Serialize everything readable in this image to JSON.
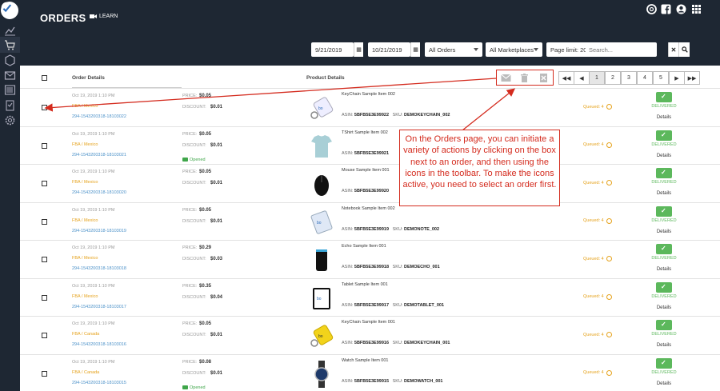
{
  "header": {
    "title": "ORDERS",
    "learn_label": "LEARN",
    "icons": [
      "help-ring-icon",
      "facebook-icon",
      "user-icon",
      "apps-grid-icon"
    ]
  },
  "sidebar": {
    "items": [
      "logo-icon",
      "chart-icon",
      "cart-icon",
      "box-icon",
      "mail-icon",
      "barcode-icon",
      "clipboard-icon",
      "settings-icon"
    ]
  },
  "filters": {
    "date_from": "9/21/2019",
    "date_to": "10/21/2019",
    "order_filter": "All Orders",
    "marketplace_filter": "All Marketplaces",
    "page_limit": "Page limit: 20",
    "search_placeholder": "Search..."
  },
  "table": {
    "col_order": "Order Details",
    "col_product": "Product Details"
  },
  "pagination": [
    "1",
    "2",
    "3",
    "4",
    "5"
  ],
  "labels": {
    "price": "PRICE:",
    "discount": "DISCOUNT:",
    "asin": "ASIN:",
    "sku": "SKU:",
    "delivered": "DELIVERED",
    "details": "Details",
    "opened": "Opened"
  },
  "orders": [
    {
      "date": "Oct 19, 2019 1:10 PM",
      "fba": "FBA / Mexico",
      "id": "294-1543200318-18103022",
      "price": "$0.05",
      "discount": "$0.01",
      "opened": false,
      "product": "KeyChain Sample Item 002",
      "asin": "5BFB5E3E99922",
      "sku": "DEMOKEYCHAIN_002",
      "queued": "Queued: 4",
      "thumb": "keychain"
    },
    {
      "date": "Oct 19, 2019 1:10 PM",
      "fba": "FBA / Mexico",
      "id": "294-1543200318-18103021",
      "price": "$0.05",
      "discount": "$0.01",
      "opened": true,
      "product": "TShirt Sample Item 002",
      "asin": "5BFB5E3E99921",
      "sku": "",
      "queued": "Queued: 4",
      "thumb": "tshirt"
    },
    {
      "date": "Oct 19, 2019 1:10 PM",
      "fba": "FBA / Mexico",
      "id": "294-1543200318-18103020",
      "price": "$0.05",
      "discount": "$0.01",
      "opened": false,
      "product": "Mouse Sample Item 001",
      "asin": "5BFB5E3E99920",
      "sku": "",
      "queued": "Queued: 4",
      "thumb": "mouse"
    },
    {
      "date": "Oct 19, 2019 1:10 PM",
      "fba": "FBA / Mexico",
      "id": "294-1543200318-18103019",
      "price": "$0.05",
      "discount": "$0.01",
      "opened": false,
      "product": "Notebook Sample Item 002",
      "asin": "5BFB5E3E99919",
      "sku": "DEMONOTE_002",
      "queued": "Queued: 4",
      "thumb": "notebook"
    },
    {
      "date": "Oct 19, 2019 1:10 PM",
      "fba": "FBA / Mexico",
      "id": "294-1543200318-18103018",
      "price": "$0.29",
      "discount": "$0.03",
      "opened": false,
      "product": "Echo Sample Item 001",
      "asin": "5BFB5E3E99918",
      "sku": "DEMOECHO_001",
      "queued": "Queued: 4",
      "thumb": "echo"
    },
    {
      "date": "Oct 19, 2019 1:10 PM",
      "fba": "FBA / Mexico",
      "id": "294-1543200318-18103017",
      "price": "$0.35",
      "discount": "$0.04",
      "opened": false,
      "product": "Tablet Sample Item 001",
      "asin": "5BFB5E3E99917",
      "sku": "DEMOTABLET_001",
      "queued": "Queued: 4",
      "thumb": "tablet"
    },
    {
      "date": "Oct 19, 2019 1:10 PM",
      "fba": "FBA / Canada",
      "id": "294-1543200318-18103016",
      "price": "$0.05",
      "discount": "$0.01",
      "opened": false,
      "product": "KeyChain Sample Item 001",
      "asin": "5BFB5E3E99916",
      "sku": "DEMOKEYCHAIN_001",
      "queued": "Queued: 4",
      "thumb": "keychain-yellow"
    },
    {
      "date": "Oct 19, 2019 1:10 PM",
      "fba": "FBA / Canada",
      "id": "294-1543200318-18103015",
      "price": "$0.08",
      "discount": "$0.01",
      "opened": true,
      "product": "Watch Sample Item 001",
      "asin": "5BFB5E3E99915",
      "sku": "DEMOWATCH_001",
      "queued": "Queued: 4",
      "thumb": "watch"
    }
  ],
  "annotation": {
    "text": "On the Orders page, you can initiate a variety of actions by clicking on the box next to an order, and then using the icons in the toolbar. To make the icons active, you need to select an order first.",
    "color": "#d42b1e"
  },
  "toolbar": {
    "icons": [
      "email-icon",
      "trash-icon",
      "cancel-icon"
    ]
  }
}
